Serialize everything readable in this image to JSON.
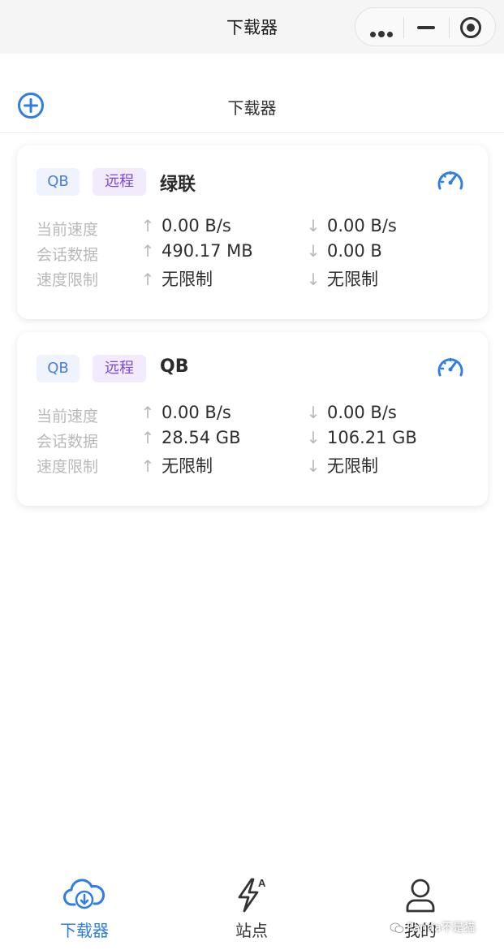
{
  "navbar": {
    "title": "下载器",
    "capsule": {
      "more_icon": "more-dots-icon",
      "minimize_icon": "minus-icon",
      "close_icon": "target-icon"
    }
  },
  "header": {
    "title": "下载器",
    "add_icon": "plus-circle-icon"
  },
  "labels": {
    "current_speed": "当前速度",
    "session_data": "会话数据",
    "speed_limit": "速度限制",
    "up_arrow": "↑",
    "down_arrow": "↓"
  },
  "downloaders": [
    {
      "type": "QB",
      "mode": "远程",
      "name": "绿联",
      "current_up": "0.00 B/s",
      "current_down": "0.00 B/s",
      "session_up": "490.17 MB",
      "session_down": "0.00 B",
      "limit_up": "无限制",
      "limit_down": "无限制"
    },
    {
      "type": "QB",
      "mode": "远程",
      "name": "QB",
      "current_up": "0.00 B/s",
      "current_down": "0.00 B/s",
      "session_up": "28.54 GB",
      "session_down": "106.21 GB",
      "limit_up": "无限制",
      "limit_down": "无限制"
    }
  ],
  "tabbar": {
    "items": [
      {
        "label": "下载器",
        "icon": "cloud-download-icon",
        "active": true
      },
      {
        "label": "站点",
        "icon": "lightning-a-icon",
        "active": false
      },
      {
        "label": "我的",
        "icon": "user-icon",
        "active": false
      }
    ]
  },
  "watermark": {
    "text": "Panda不是猫"
  },
  "colors": {
    "accent": "#2f7ee6",
    "tag_type_bg": "#eef3fd",
    "tag_type_text": "#4a7fd9",
    "tag_remote_bg": "#f1ebfd",
    "tag_remote_text": "#7a47d6",
    "muted": "#b9b9b9"
  }
}
